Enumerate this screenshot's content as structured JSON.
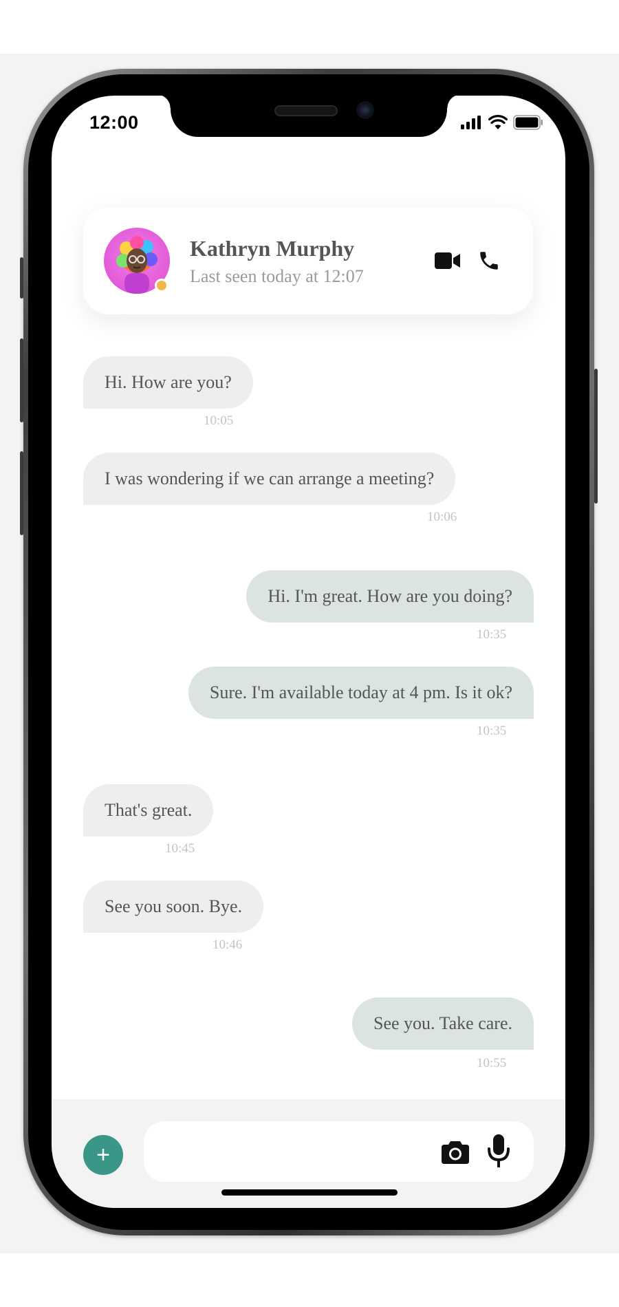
{
  "status_bar": {
    "time": "12:00",
    "icons": [
      "cellular-signal-icon",
      "wifi-icon",
      "battery-icon"
    ]
  },
  "header": {
    "contact_name": "Kathryn Murphy",
    "last_seen": "Last seen today at 12:07",
    "online_status_color": "#f4b64a",
    "actions": [
      "video-camera-icon",
      "phone-icon"
    ]
  },
  "messages": [
    {
      "direction": "received",
      "text": "Hi. How are you?",
      "time": "10:05"
    },
    {
      "direction": "received",
      "text": "I was wondering if we can arrange a meeting?",
      "time": "10:06"
    },
    {
      "direction": "sent",
      "text": "Hi. I'm great. How are you doing?",
      "time": "10:35"
    },
    {
      "direction": "sent",
      "text": "Sure. I'm available today at 4 pm. Is it ok?",
      "time": "10:35"
    },
    {
      "direction": "received",
      "text": "That's great.",
      "time": "10:45"
    },
    {
      "direction": "received",
      "text": "See you soon. Bye.",
      "time": "10:46"
    },
    {
      "direction": "sent",
      "text": "See you. Take care.",
      "time": "10:55"
    }
  ],
  "composer": {
    "add_label": "+",
    "message_value": "",
    "placeholder": "",
    "icons": [
      "camera-icon",
      "microphone-icon"
    ]
  },
  "colors": {
    "received_bubble": "#eeeeee",
    "sent_bubble": "#dbe4e2",
    "accent": "#3a9686",
    "timestamp": "#c4c4c4"
  }
}
